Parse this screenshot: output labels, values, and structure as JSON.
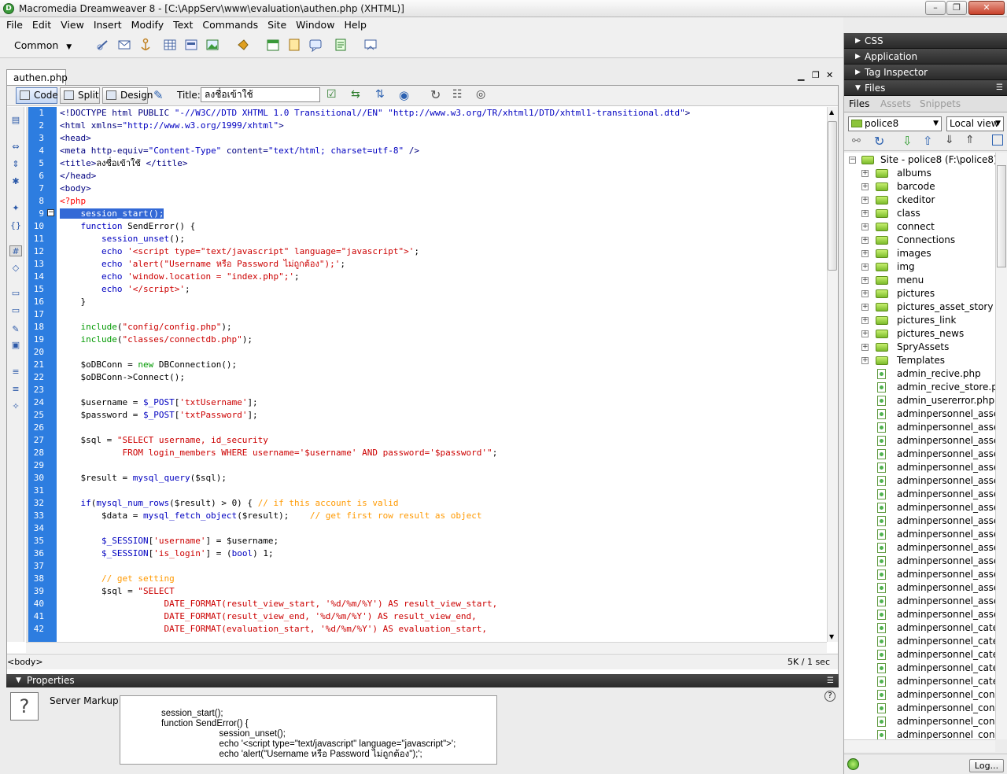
{
  "window": {
    "title": "Macromedia Dreamweaver 8 - [C:\\AppServ\\www\\evaluation\\authen.php (XHTML)]",
    "minimize_glyph": "–",
    "maximize_glyph": "❐",
    "close_glyph": "✕"
  },
  "menu": [
    "File",
    "Edit",
    "View",
    "Insert",
    "Modify",
    "Text",
    "Commands",
    "Site",
    "Window",
    "Help"
  ],
  "insert_bar": {
    "category": "Common"
  },
  "document": {
    "tab": "authen.php",
    "views": {
      "code": "Code",
      "split": "Split",
      "design": "Design"
    },
    "title_label": "Title:",
    "title_value": "ลงชื่อเข้าใช้",
    "status_tag": "<body>",
    "status_size": "5K / 1 sec"
  },
  "code_lines": [
    {
      "n": "1",
      "html": "<span class='tag'>&lt;!DOCTYPE html PUBLIC </span><span class='str'>\"-//W3C//DTD XHTML 1.0 Transitional//EN\" \"http://www.w3.org/TR/xhtml1/DTD/xhtml1-transitional.dtd\"</span><span class='tag'>&gt;</span>"
    },
    {
      "n": "2",
      "html": "<span class='tag'>&lt;html xmlns=</span><span class='str'>\"http://www.w3.org/1999/xhtml\"</span><span class='tag'>&gt;</span>"
    },
    {
      "n": "3",
      "html": "<span class='tag'>&lt;head&gt;</span>"
    },
    {
      "n": "4",
      "html": "<span class='tag'>&lt;meta http-equiv=</span><span class='str'>\"Content-Type\"</span><span class='tag'> content=</span><span class='str'>\"text/html; charset=utf-8\"</span><span class='tag'> /&gt;</span>"
    },
    {
      "n": "5",
      "html": "<span class='tag'>&lt;title&gt;</span>ลงชื่อเข้าใช้ <span class='tag'>&lt;/title&gt;</span>"
    },
    {
      "n": "6",
      "html": "<span class='tag'>&lt;/head&gt;</span>"
    },
    {
      "n": "7",
      "html": "<span class='tag'>&lt;body&gt;</span>"
    },
    {
      "n": "8",
      "html": "<span class='php'>&lt;?php</span>"
    },
    {
      "n": "9",
      "html": "<span class='sel'>    session_start();</span>"
    },
    {
      "n": "10",
      "html": "    <span class='str'>function</span> SendError() {"
    },
    {
      "n": "11",
      "html": "        <span class='str'>session_unset</span>();"
    },
    {
      "n": "12",
      "html": "        <span class='str'>echo</span> <span class='red'>'&lt;script type=\"text/javascript\" language=\"javascript\"&gt;'</span>;"
    },
    {
      "n": "13",
      "html": "        <span class='str'>echo</span> <span class='red'>'alert(\"Username หรือ Password ไม่ถูกต้อง\");'</span>;"
    },
    {
      "n": "14",
      "html": "        <span class='str'>echo</span> <span class='red'>'window.location = \"index.php\";'</span>;"
    },
    {
      "n": "15",
      "html": "        <span class='str'>echo</span> <span class='red'>'&lt;/script&gt;'</span>;"
    },
    {
      "n": "16",
      "html": "    }"
    },
    {
      "n": "17",
      "html": ""
    },
    {
      "n": "18",
      "html": "    <span class='fn'>include</span>(<span class='red'>\"config/config.php\"</span>);"
    },
    {
      "n": "19",
      "html": "    <span class='fn'>include</span>(<span class='red'>\"classes/connectdb.php\"</span>);"
    },
    {
      "n": "20",
      "html": ""
    },
    {
      "n": "21",
      "html": "    $oDBConn = <span class='fn'>new</span> DBConnection();"
    },
    {
      "n": "22",
      "html": "    $oDBConn-&gt;Connect();"
    },
    {
      "n": "23",
      "html": ""
    },
    {
      "n": "24",
      "html": "    $username = <span class='str'>$_POST</span>[<span class='red'>'txtUsername'</span>];"
    },
    {
      "n": "25",
      "html": "    $password = <span class='str'>$_POST</span>[<span class='red'>'txtPassword'</span>];"
    },
    {
      "n": "26",
      "html": ""
    },
    {
      "n": "27",
      "html": "    $sql = <span class='red'>\"SELECT username, id_security</span>"
    },
    {
      "n": "28",
      "html": "<span class='red'>            FROM login_members WHERE username='$username' AND password='$password'\"</span>;"
    },
    {
      "n": "29",
      "html": ""
    },
    {
      "n": "30",
      "html": "    $result = <span class='str'>mysql_query</span>($sql);"
    },
    {
      "n": "31",
      "html": ""
    },
    {
      "n": "32",
      "html": "    <span class='str'>if</span>(<span class='str'>mysql_num_rows</span>($result) &gt; 0) { <span class='cmt'>// if this account is valid</span>"
    },
    {
      "n": "33",
      "html": "        $data = <span class='str'>mysql_fetch_object</span>($result);    <span class='cmt'>// get first row result as object</span>"
    },
    {
      "n": "34",
      "html": ""
    },
    {
      "n": "35",
      "html": "        <span class='str'>$_SESSION</span>[<span class='red'>'username'</span>] = $username;"
    },
    {
      "n": "36",
      "html": "        <span class='str'>$_SESSION</span>[<span class='red'>'is_login'</span>] = (<span class='str'>bool</span>) 1;"
    },
    {
      "n": "37",
      "html": ""
    },
    {
      "n": "38",
      "html": "        <span class='cmt'>// get setting</span>"
    },
    {
      "n": "39",
      "html": "        $sql = <span class='red'>\"SELECT</span>"
    },
    {
      "n": "40",
      "html": "<span class='red'>                    DATE_FORMAT(result_view_start, '%d/%m/%Y') AS result_view_start,</span>"
    },
    {
      "n": "41",
      "html": "<span class='red'>                    DATE_FORMAT(result_view_end, '%d/%m/%Y') AS result_view_end,</span>"
    },
    {
      "n": "42",
      "html": "<span class='red'>                    DATE_FORMAT(evaluation_start, '%d/%m/%Y') AS evaluation_start,</span>"
    }
  ],
  "properties": {
    "header": "Properties",
    "type_label": "Server Markup",
    "help_glyph": "?",
    "code": [
      "session_start();",
      "function SendError() {",
      "        session_unset();",
      "        echo '<script type=\"text/javascript\" language=\"javascript\">';",
      "        echo 'alert(\"Username หรือ Password ไม่ถูกต้อง\");';"
    ]
  },
  "panels": {
    "css": "CSS",
    "application": "Application",
    "tag_inspector": "Tag Inspector",
    "files": "Files"
  },
  "files_panel": {
    "tabs": [
      "Files",
      "Assets",
      "Snippets"
    ],
    "site": "police8",
    "view": "Local view",
    "root": "Site - police8 (F:\\police8)",
    "folders": [
      "albums",
      "barcode",
      "ckeditor",
      "class",
      "connect",
      "Connections",
      "images",
      "img",
      "menu",
      "pictures",
      "pictures_asset_story",
      "pictures_link",
      "pictures_news",
      "SpryAssets",
      "Templates"
    ],
    "files": [
      "admin_recive.php",
      "admin_recive_store.php",
      "admin_usererror.php",
      "adminpersonnel_asset_ac",
      "adminpersonnel_asset_ac",
      "adminpersonnel_asset_de",
      "adminpersonnel_asset_de",
      "adminpersonnel_asset_ec",
      "adminpersonnel_asset_ec",
      "adminpersonnel_asset_nc",
      "adminpersonnel_asset_nc",
      "adminpersonnel_asset_re",
      "adminpersonnel_asset_re",
      "adminpersonnel_asset_sh",
      "adminpersonnel_asset_ty",
      "adminpersonnel_asset_ty",
      "adminpersonnel_asset_ty",
      "adminpersonnel_asset_ty",
      "adminpersonnel_asset_ty",
      "adminpersonnel_category",
      "adminpersonnel_category",
      "adminpersonnel_category",
      "adminpersonnel_category",
      "adminpersonnel_category",
      "adminpersonnel_conditior",
      "adminpersonnel_conditior",
      "adminpersonnel_contact.",
      "adminpersonnel_contact_"
    ],
    "log_button": "Log..."
  }
}
